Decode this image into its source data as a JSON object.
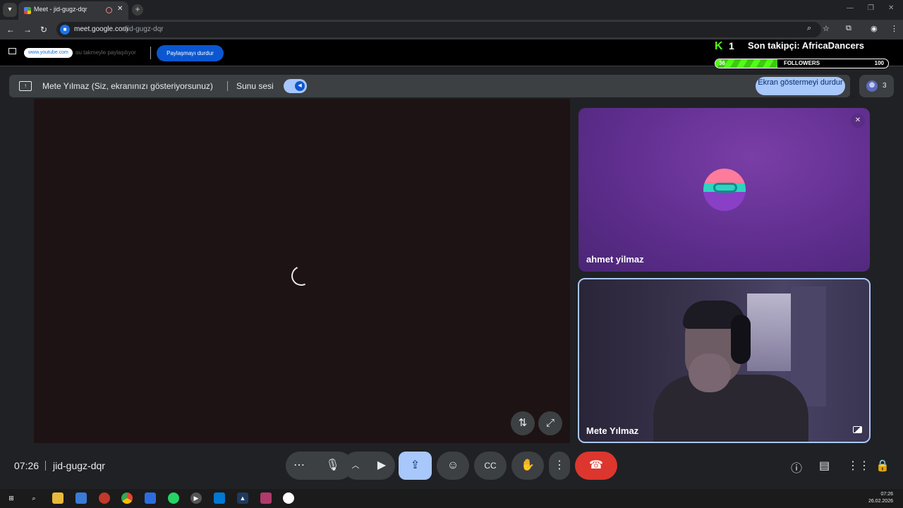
{
  "browser": {
    "tab_title": "Meet - jid-gugz-dqr",
    "url_host": "meet.google.com",
    "url_path": "/jid-gugz-dqr"
  },
  "share_banner": {
    "site": "www.youtube.com",
    "text": "ou takmeyle paylaşılıyor",
    "stop_label": "Paylaşmayı durdur"
  },
  "overlay": {
    "count": "1",
    "latest_follower": "Son takipçi: AfricaDancers",
    "bar_min": "36",
    "bar_label": "FOLLOWERS",
    "bar_max": "100",
    "bar_progress": 0.36
  },
  "presenting": {
    "name": "Mete Yılmaz (Siz, ekranınızı gösteriyorsunuz)",
    "audio_label": "Sunu sesi",
    "stop_button": "Ekran göstermeyi durdur",
    "people_count": "3"
  },
  "participants": [
    {
      "name": "ahmet yilmaz"
    },
    {
      "name": "Mete Yılmaz"
    }
  ],
  "meeting": {
    "time": "07:26",
    "code": "jid-gugz-dqr"
  },
  "taskbar": {
    "time": "07:26",
    "date": "26.02.2026"
  },
  "colors": {
    "accent": "#a8c7fa",
    "leave": "#dc362e",
    "kick_green": "#53fc18"
  }
}
